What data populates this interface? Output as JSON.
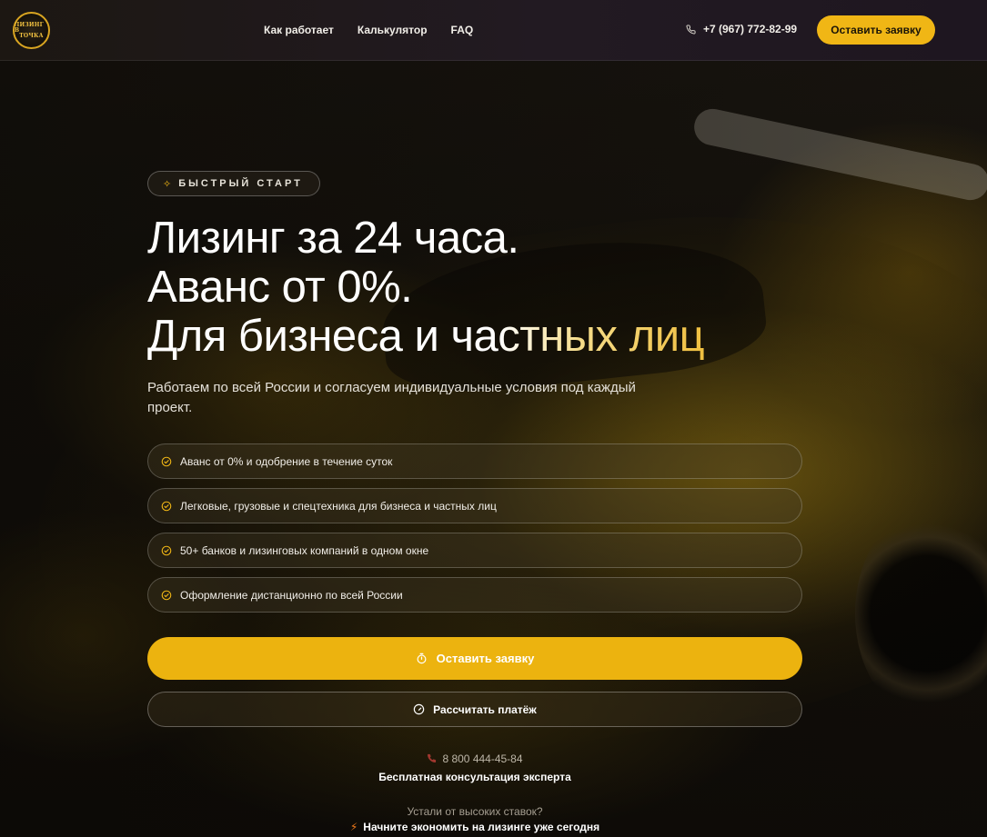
{
  "logo": {
    "line1": "ЛИЗИНГ В",
    "line2": "ТОЧКА"
  },
  "nav": {
    "items": [
      {
        "label": "Как работает"
      },
      {
        "label": "Калькулятор"
      },
      {
        "label": "FAQ"
      }
    ]
  },
  "header": {
    "phone": "+7 (967) 772-82-99",
    "cta_label": "Оставить заявку"
  },
  "hero": {
    "badge": "БЫСТРЫЙ СТАРТ",
    "title_line1": "Лизинг за 24 часа.",
    "title_line2": "Аванс от 0%.",
    "title_line3_plain": "Для бизнеса и ча",
    "title_line3_gold": "стных лиц",
    "lead": "Работаем по всей России и согласуем индивидуальные условия под каждый проект.",
    "features": [
      {
        "text": "Аванс от 0% и одобрение в течение суток"
      },
      {
        "text": "Легковые, грузовые и спецтехника для бизнеса и частных лиц"
      },
      {
        "text": "50+ банков и лизинговых компаний в одном окне"
      },
      {
        "text": "Оформление дистанционно по всей России"
      }
    ],
    "primary_button": "Оставить заявку",
    "secondary_button": "Рассчитать платёж",
    "consult_phone": "8 800 444-45-84",
    "consult_text": "Бесплатная консультация эксперта",
    "tired_question": "Устали от высоких ставок?",
    "tired_answer": "Начните экономить на лизинге уже сегодня"
  },
  "colors": {
    "accent": "#f0b615",
    "header_bg": "#1e1620",
    "page_bg": "#120f0b"
  },
  "icons": {
    "phone": "phone-icon",
    "badge": "sparkle-icon",
    "feature": "check-circle-icon",
    "primary": "stopwatch-icon",
    "secondary": "gauge-icon",
    "tired": "bolt-icon"
  }
}
